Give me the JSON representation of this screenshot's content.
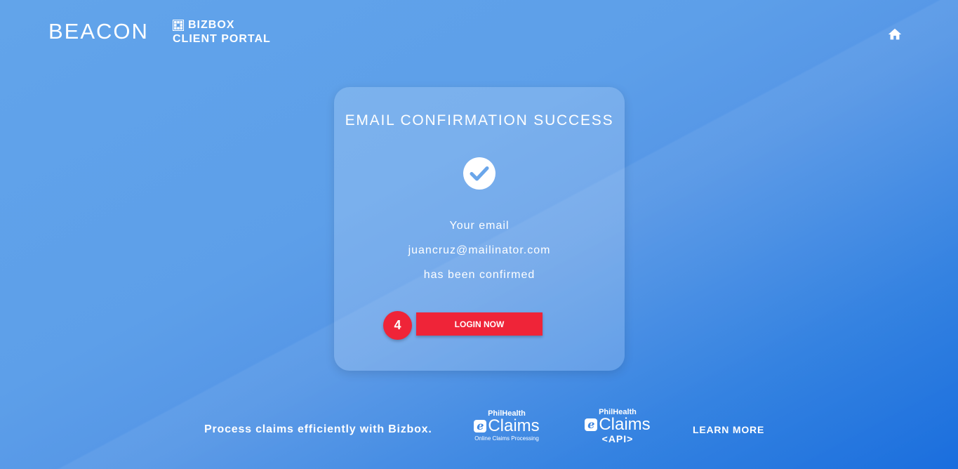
{
  "header": {
    "brand": "BEACON",
    "product_line1": "BIZBOX",
    "product_line2": "CLIENT PORTAL",
    "home_icon": "home-icon"
  },
  "card": {
    "title": "EMAIL CONFIRMATION SUCCESS",
    "icon": "check-circle-icon",
    "line1": "Your email",
    "email": "juancruz@mailinator.com",
    "line3": "has been confirmed",
    "step_badge": "4",
    "login_label": "LOGIN NOW"
  },
  "footer": {
    "tagline": "Process claims efficiently with Bizbox.",
    "eclaims": {
      "top": "PhilHealth",
      "e": "e",
      "name": "Claims",
      "sub": "Online Claims Processing"
    },
    "eclaims_api": {
      "top": "PhilHealth",
      "e": "e",
      "name": "Claims",
      "sub": "<API>"
    },
    "learn_more": "LEARN MORE"
  },
  "colors": {
    "accent_red": "#ef2438",
    "background_blue": "#5d9fe9"
  }
}
